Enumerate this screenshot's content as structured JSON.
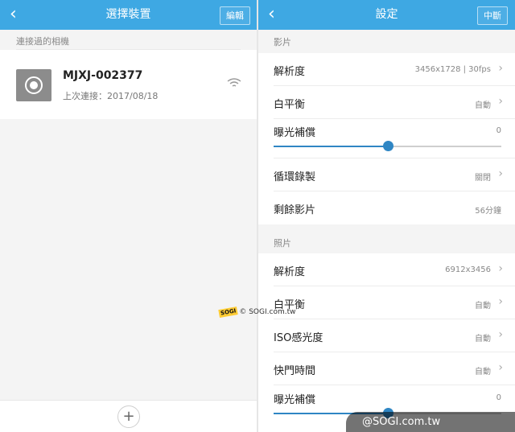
{
  "left": {
    "header": {
      "title": "選擇裝置",
      "edit_label": "編輯",
      "back_icon": "chevron-left-icon"
    },
    "section_label": "連接過的相機",
    "device": {
      "name": "MJXJ-002377",
      "last_connection": "上次連接：2017/08/18",
      "icon": "camera-icon",
      "signal_icon": "wifi-icon"
    },
    "add_icon": "plus-icon"
  },
  "right": {
    "header": {
      "title": "設定",
      "stop_label": "中斷",
      "back_icon": "chevron-left-icon"
    },
    "video": {
      "section_label": "影片",
      "resolution": {
        "label": "解析度",
        "value": "3456x1728 | 30fps"
      },
      "white_balance": {
        "label": "白平衡",
        "value": "自動"
      },
      "exposure": {
        "label": "曝光補償",
        "value": "0",
        "slider_fraction": 0.5
      },
      "loop_recording": {
        "label": "循環錄製",
        "value": "關閉"
      },
      "remaining": {
        "label": "剩餘影片",
        "value": "56分鐘"
      }
    },
    "photo": {
      "section_label": "照片",
      "resolution": {
        "label": "解析度",
        "value": "6912x3456"
      },
      "white_balance": {
        "label": "白平衡",
        "value": "自動"
      },
      "iso": {
        "label": "ISO感光度",
        "value": "自動"
      },
      "shutter": {
        "label": "快門時間",
        "value": "自動"
      },
      "exposure": {
        "label": "曝光補償",
        "value": "0",
        "slider_fraction": 0.5
      }
    }
  },
  "watermarks": {
    "small_badge": "SOGI",
    "small": "© SOGI.com.tw",
    "large": "@SOGI.com.tw"
  },
  "colors": {
    "header": "#3ea8e3",
    "accent": "#2f86c4"
  }
}
